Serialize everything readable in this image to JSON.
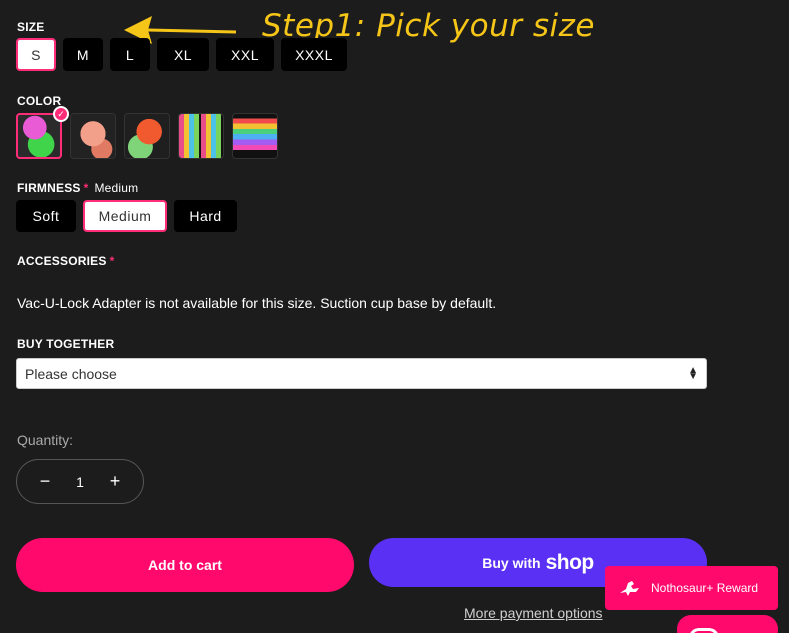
{
  "annotation": {
    "text": "Step1: Pick your size",
    "color": "#f5c518"
  },
  "size": {
    "label": "SIZE",
    "options": [
      "S",
      "M",
      "L",
      "XL",
      "XXL",
      "XXXL"
    ],
    "selected": "S"
  },
  "color": {
    "label": "COLOR",
    "swatches": [
      {
        "name": "green-pink-swatch",
        "selected": true
      },
      {
        "name": "peach-swatch",
        "selected": false
      },
      {
        "name": "orange-green-swatch",
        "selected": false
      },
      {
        "name": "color-chart-swatch",
        "selected": false
      },
      {
        "name": "rainbow-swatch",
        "selected": false
      }
    ]
  },
  "firmness": {
    "label": "FIRMNESS",
    "required_mark": "*",
    "current": "Medium",
    "options": [
      "Soft",
      "Medium",
      "Hard"
    ],
    "selected": "Medium"
  },
  "accessories": {
    "label": "ACCESSORIES",
    "required_mark": "*",
    "message": "Vac-U-Lock Adapter is not available for this size. Suction cup base by default."
  },
  "buy_together": {
    "label": "BUY TOGETHER",
    "selected": "Please choose"
  },
  "quantity": {
    "label": "Quantity:",
    "value": "1",
    "minus": "−",
    "plus": "+"
  },
  "actions": {
    "add_to_cart": "Add to cart",
    "buy_with": "Buy with",
    "shop": "shop",
    "more_payment": "More payment options"
  },
  "reward": {
    "label": "Nothosaur+ Reward"
  },
  "colors": {
    "accent": "#ff0a6c",
    "shop": "#5a31f4",
    "background": "#1c1c1c"
  }
}
